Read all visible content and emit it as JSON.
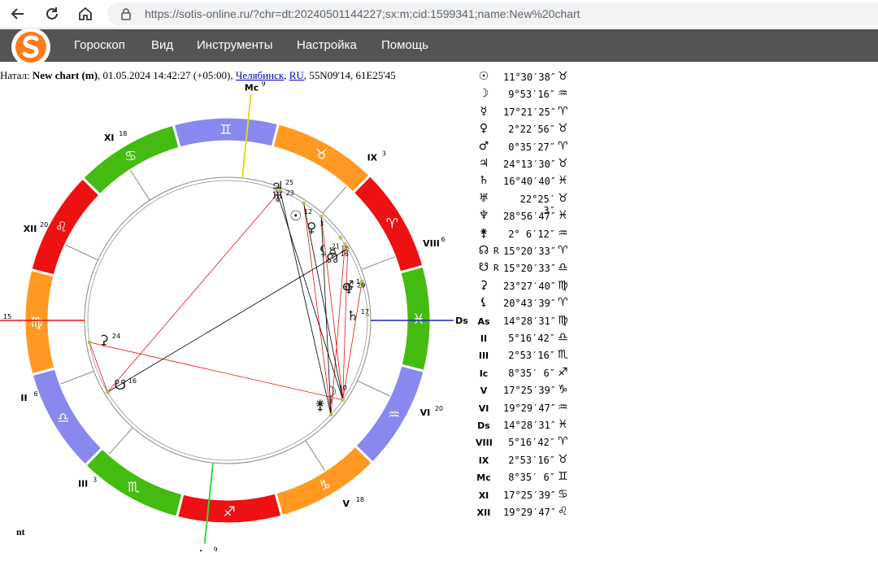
{
  "browser": {
    "url": "https://sotis-online.ru/?chr=dt:20240501144227;sx:m;cid:1599341;name:New%20chart"
  },
  "menu": {
    "items": [
      "Гороскоп",
      "Вид",
      "Инструменты",
      "Настройка",
      "Помощь"
    ]
  },
  "natal": {
    "prefix": "Натал:",
    "name": "New chart (m)",
    "datetime": ", 01.05.2024 14:42:27 (+05:00), ",
    "city": "Челябинск",
    "sep": ", ",
    "country": "RU",
    "coords": ", 55N09'14, 61E25'45"
  },
  "footer_text": "nt",
  "colors": {
    "fire": "#ee1111",
    "earth": "#ff9922",
    "air": "#8888ee",
    "water": "#44bb11",
    "menubar": "#545454"
  },
  "wheel": {
    "signs": [
      {
        "glyph": "♈",
        "lon": 0
      },
      {
        "glyph": "♉",
        "lon": 30
      },
      {
        "glyph": "♊",
        "lon": 60
      },
      {
        "glyph": "♋",
        "lon": 90
      },
      {
        "glyph": "♌",
        "lon": 120
      },
      {
        "glyph": "♍",
        "lon": 150
      },
      {
        "glyph": "♎",
        "lon": 180
      },
      {
        "glyph": "♏",
        "lon": 210
      },
      {
        "glyph": "♐",
        "lon": 240
      },
      {
        "glyph": "♑",
        "lon": 270
      },
      {
        "glyph": "♒",
        "lon": 300
      },
      {
        "glyph": "♓",
        "lon": 330
      }
    ],
    "houses": [
      {
        "label": "As",
        "deg": "15",
        "lon": 164.47
      },
      {
        "label": "II",
        "deg": "6",
        "lon": 185.28
      },
      {
        "label": "III",
        "deg": "3",
        "lon": 212.89
      },
      {
        "label": "Ic",
        "deg": "9",
        "lon": 248.59
      },
      {
        "label": "V",
        "deg": "18",
        "lon": 287.42
      },
      {
        "label": "VI",
        "deg": "20",
        "lon": 319.5
      },
      {
        "label": "Ds",
        "deg": "15",
        "lon": 344.47
      },
      {
        "label": "VIII",
        "deg": "6",
        "lon": 5.28
      },
      {
        "label": "IX",
        "deg": "3",
        "lon": 32.89
      },
      {
        "label": "Mc",
        "deg": "9",
        "lon": 68.59
      },
      {
        "label": "XI",
        "deg": "18",
        "lon": 107.42
      },
      {
        "label": "XII",
        "deg": "20",
        "lon": 139.5
      }
    ],
    "planets": [
      {
        "glyph": "☉",
        "deg": "12",
        "lon": 41.5
      },
      {
        "glyph": "☽",
        "deg": "10",
        "lon": 309.9
      },
      {
        "glyph": "☿",
        "deg": "18",
        "lon": 17.4
      },
      {
        "glyph": "♀",
        "deg": "3",
        "lon": 32.4
      },
      {
        "glyph": "♂",
        "deg": "1",
        "lon": 0.6
      },
      {
        "glyph": "♃",
        "deg": "25",
        "lon": 54.2
      },
      {
        "glyph": "♄",
        "deg": "17",
        "lon": 346.7
      },
      {
        "glyph": "♅",
        "deg": "23",
        "lon": 52.4
      },
      {
        "glyph": "♆",
        "deg": "29",
        "lon": 358.9
      },
      {
        "glyph": "⚵",
        "deg": "3",
        "lon": 302.1
      },
      {
        "glyph": "☊",
        "deg": "16",
        "lon": 15.3
      },
      {
        "glyph": "☋",
        "deg": "16",
        "lon": 195.3
      },
      {
        "glyph": "⚳",
        "deg": "24",
        "lon": 173.5
      },
      {
        "glyph": "⚸",
        "deg": "21",
        "lon": 20.7
      }
    ]
  },
  "positions": [
    {
      "symbol": "☉",
      "value": "11°30′38″",
      "r": "",
      "sign": "♉"
    },
    {
      "symbol": "☽",
      "value": "9°53′16″",
      "r": "",
      "sign": "♒"
    },
    {
      "symbol": "☿",
      "value": "17°21′25″",
      "r": "",
      "sign": "♈"
    },
    {
      "symbol": "♀",
      "value": "2°22′56″",
      "r": "",
      "sign": "♉"
    },
    {
      "symbol": "♂",
      "value": "0°35′27″",
      "r": "",
      "sign": "♈"
    },
    {
      "symbol": "♃",
      "value": "24°13′30″",
      "r": "",
      "sign": "♉"
    },
    {
      "symbol": "♄",
      "value": "16°40′40″",
      "r": "",
      "sign": "♓"
    },
    {
      "symbol": "♅",
      "value": "22°25′ 3″",
      "r": "",
      "sign": "♉"
    },
    {
      "symbol": "♆",
      "value": "28°56′47″",
      "r": "",
      "sign": "♓"
    },
    {
      "symbol": "⚵",
      "value": "2° 6′12″",
      "r": "",
      "sign": "♒"
    },
    {
      "symbol": "☊",
      "value": "15°20′33″",
      "r": "R",
      "sign": "♈"
    },
    {
      "symbol": "☋",
      "value": "15°20′33″",
      "r": "R",
      "sign": "♎"
    },
    {
      "symbol": "⚳",
      "value": "23°27′40″",
      "r": "",
      "sign": "♍"
    },
    {
      "symbol": "⚸",
      "value": "20°43′39″",
      "r": "",
      "sign": "♈"
    },
    {
      "symbol": "As",
      "value": "14°28′31″",
      "r": "",
      "sign": "♍"
    },
    {
      "symbol": "II",
      "value": "5°16′42″",
      "r": "",
      "sign": "♎"
    },
    {
      "symbol": "III",
      "value": "2°53′16″",
      "r": "",
      "sign": "♏"
    },
    {
      "symbol": "Ic",
      "value": "8°35′ 6″",
      "r": "",
      "sign": "♐"
    },
    {
      "symbol": "V",
      "value": "17°25′39″",
      "r": "",
      "sign": "♑"
    },
    {
      "symbol": "VI",
      "value": "19°29′47″",
      "r": "",
      "sign": "♒"
    },
    {
      "symbol": "Ds",
      "value": "14°28′31″",
      "r": "",
      "sign": "♓"
    },
    {
      "symbol": "VIII",
      "value": "5°16′42″",
      "r": "",
      "sign": "♈"
    },
    {
      "symbol": "IX",
      "value": "2°53′16″",
      "r": "",
      "sign": "♉"
    },
    {
      "symbol": "Mc",
      "value": "8°35′ 6″",
      "r": "",
      "sign": "♊"
    },
    {
      "symbol": "XI",
      "value": "17°25′39″",
      "r": "",
      "sign": "♋"
    },
    {
      "symbol": "XII",
      "value": "19°29′47″",
      "r": "",
      "sign": "♌"
    }
  ]
}
